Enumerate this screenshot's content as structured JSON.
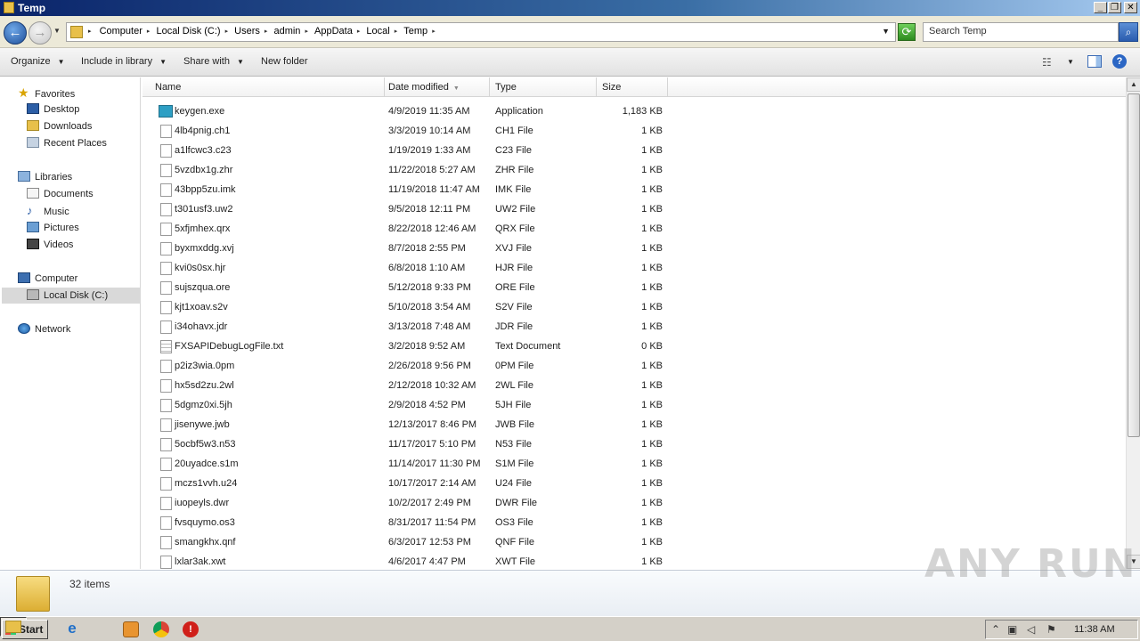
{
  "window": {
    "title": "Temp"
  },
  "address": {
    "crumbs": [
      "Computer",
      "Local Disk (C:)",
      "Users",
      "admin",
      "AppData",
      "Local",
      "Temp"
    ]
  },
  "search": {
    "placeholder": "Search Temp"
  },
  "toolbar": {
    "organize": "Organize",
    "include_in_library": "Include in library",
    "share_with": "Share with",
    "new_folder": "New folder"
  },
  "navigation": {
    "favorites": "Favorites",
    "desktop": "Desktop",
    "downloads": "Downloads",
    "recent_places": "Recent Places",
    "libraries": "Libraries",
    "documents": "Documents",
    "music": "Music",
    "pictures": "Pictures",
    "videos": "Videos",
    "computer": "Computer",
    "local_disk": "Local Disk (C:)",
    "network": "Network"
  },
  "columns": {
    "name": "Name",
    "date": "Date modified",
    "type": "Type",
    "size": "Size"
  },
  "files": [
    {
      "name": "keygen.exe",
      "date": "4/9/2019 11:35 AM",
      "type": "Application",
      "size": "1,183 KB",
      "icon": "app"
    },
    {
      "name": "4lb4pnig.ch1",
      "date": "3/3/2019 10:14 AM",
      "type": "CH1 File",
      "size": "1 KB",
      "icon": "file"
    },
    {
      "name": "a1lfcwc3.c23",
      "date": "1/19/2019 1:33 AM",
      "type": "C23 File",
      "size": "1 KB",
      "icon": "file"
    },
    {
      "name": "5vzdbx1g.zhr",
      "date": "11/22/2018 5:27 AM",
      "type": "ZHR File",
      "size": "1 KB",
      "icon": "file"
    },
    {
      "name": "43bpp5zu.imk",
      "date": "11/19/2018 11:47 AM",
      "type": "IMK File",
      "size": "1 KB",
      "icon": "file"
    },
    {
      "name": "t301usf3.uw2",
      "date": "9/5/2018 12:11 PM",
      "type": "UW2 File",
      "size": "1 KB",
      "icon": "file"
    },
    {
      "name": "5xfjmhex.qrx",
      "date": "8/22/2018 12:46 AM",
      "type": "QRX File",
      "size": "1 KB",
      "icon": "file"
    },
    {
      "name": "byxmxddg.xvj",
      "date": "8/7/2018 2:55 PM",
      "type": "XVJ File",
      "size": "1 KB",
      "icon": "file"
    },
    {
      "name": "kvi0s0sx.hjr",
      "date": "6/8/2018 1:10 AM",
      "type": "HJR File",
      "size": "1 KB",
      "icon": "file"
    },
    {
      "name": "sujszqua.ore",
      "date": "5/12/2018 9:33 PM",
      "type": "ORE File",
      "size": "1 KB",
      "icon": "file"
    },
    {
      "name": "kjt1xoav.s2v",
      "date": "5/10/2018 3:54 AM",
      "type": "S2V File",
      "size": "1 KB",
      "icon": "file"
    },
    {
      "name": "i34ohavx.jdr",
      "date": "3/13/2018 7:48 AM",
      "type": "JDR File",
      "size": "1 KB",
      "icon": "file"
    },
    {
      "name": "FXSAPIDebugLogFile.txt",
      "date": "3/2/2018 9:52 AM",
      "type": "Text Document",
      "size": "0 KB",
      "icon": "txt"
    },
    {
      "name": "p2iz3wia.0pm",
      "date": "2/26/2018 9:56 PM",
      "type": "0PM File",
      "size": "1 KB",
      "icon": "file"
    },
    {
      "name": "hx5sd2zu.2wl",
      "date": "2/12/2018 10:32 AM",
      "type": "2WL File",
      "size": "1 KB",
      "icon": "file"
    },
    {
      "name": "5dgmz0xi.5jh",
      "date": "2/9/2018 4:52 PM",
      "type": "5JH File",
      "size": "1 KB",
      "icon": "file"
    },
    {
      "name": "jisenywe.jwb",
      "date": "12/13/2017 8:46 PM",
      "type": "JWB File",
      "size": "1 KB",
      "icon": "file"
    },
    {
      "name": "5ocbf5w3.n53",
      "date": "11/17/2017 5:10 PM",
      "type": "N53 File",
      "size": "1 KB",
      "icon": "file"
    },
    {
      "name": "20uyadce.s1m",
      "date": "11/14/2017 11:30 PM",
      "type": "S1M File",
      "size": "1 KB",
      "icon": "file"
    },
    {
      "name": "mczs1vvh.u24",
      "date": "10/17/2017 2:14 AM",
      "type": "U24 File",
      "size": "1 KB",
      "icon": "file"
    },
    {
      "name": "iuopeyls.dwr",
      "date": "10/2/2017 2:49 PM",
      "type": "DWR File",
      "size": "1 KB",
      "icon": "file"
    },
    {
      "name": "fvsquymo.os3",
      "date": "8/31/2017 11:54 PM",
      "type": "OS3 File",
      "size": "1 KB",
      "icon": "file"
    },
    {
      "name": "smangkhx.qnf",
      "date": "6/3/2017 12:53 PM",
      "type": "QNF File",
      "size": "1 KB",
      "icon": "file"
    },
    {
      "name": "lxlar3ak.xwt",
      "date": "4/6/2017 4:47 PM",
      "type": "XWT File",
      "size": "1 KB",
      "icon": "file"
    }
  ],
  "details": {
    "count": "32 items"
  },
  "taskbar": {
    "start": "Start",
    "clock": "11:38 AM"
  },
  "watermark": "ANY RUN"
}
